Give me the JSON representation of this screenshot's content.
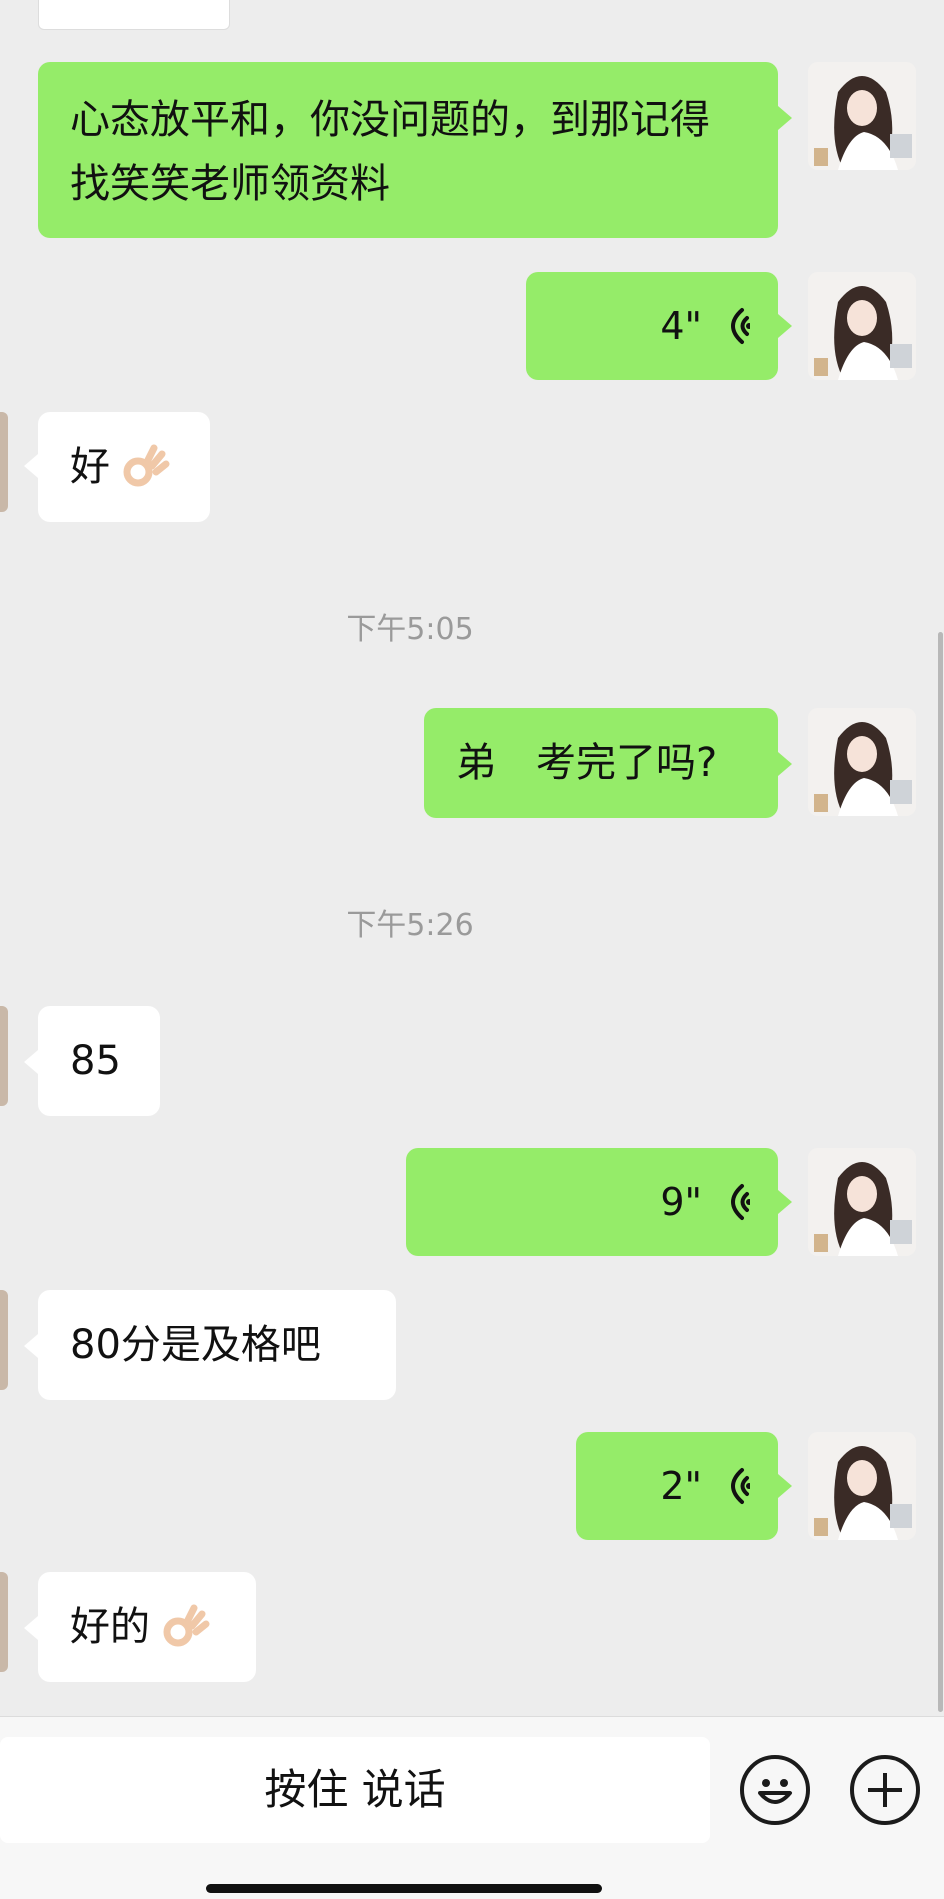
{
  "messages": {
    "m1": {
      "text": "心态放平和，你没问题的，到那记得找笑笑老师领资料"
    },
    "m2": {
      "duration": "4\""
    },
    "m3": {
      "text": "好"
    },
    "t1": {
      "time": "下午5:05"
    },
    "m4": {
      "text": "弟　考完了吗?"
    },
    "t2": {
      "time": "下午5:26"
    },
    "m5": {
      "text": "85"
    },
    "m6": {
      "duration": "9\""
    },
    "m7": {
      "text": "80分是及格吧"
    },
    "m8": {
      "duration": "2\""
    },
    "m9": {
      "text": "好的"
    }
  },
  "input_bar": {
    "hold_to_talk_label": "按住 说话"
  },
  "icons": {
    "emoji_button": "smiley-icon",
    "more_button": "plus-icon",
    "voice": "voice-wave-icon",
    "ok_emoji": "ok-hand-emoji"
  },
  "colors": {
    "sent_bubble": "#95ec69",
    "received_bubble": "#ffffff",
    "background": "#ededed"
  }
}
